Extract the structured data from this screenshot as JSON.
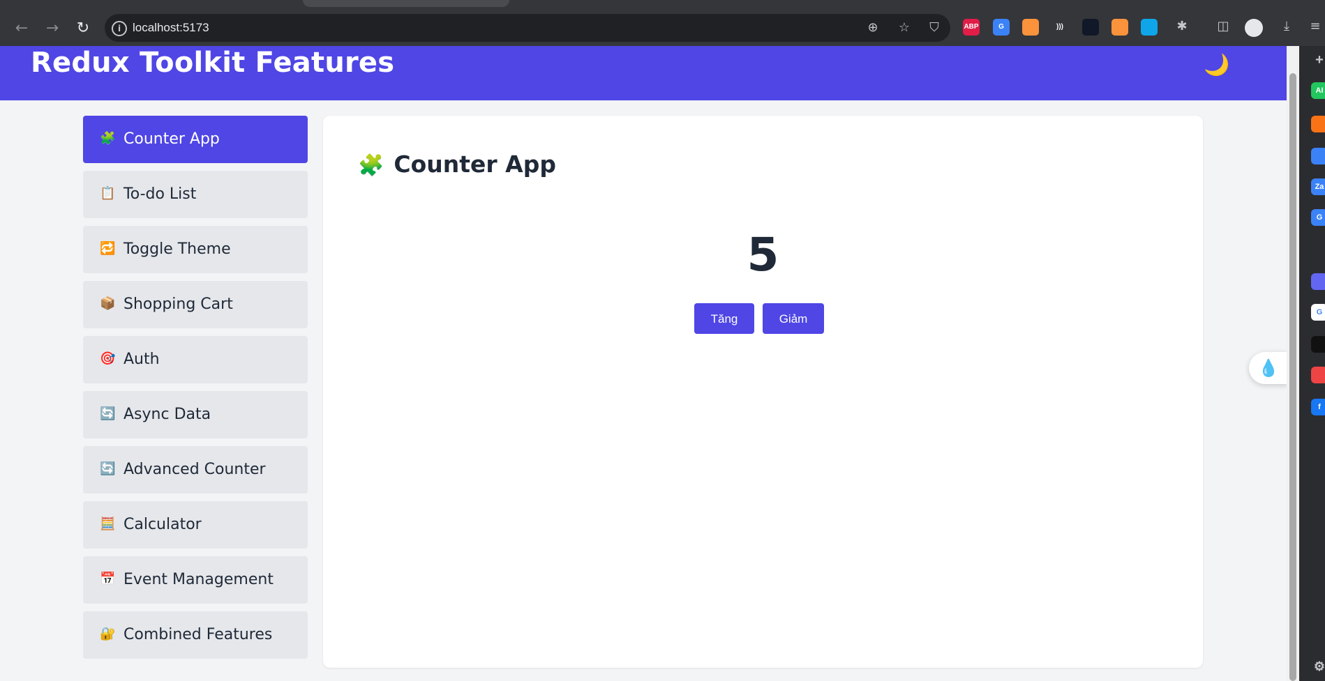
{
  "browser": {
    "url": "localhost:5173",
    "extensions": [
      {
        "name": "adblock-plus",
        "label": "ABP",
        "color": "#e11d48"
      },
      {
        "name": "google-translate",
        "label": "G",
        "color": "#3b82f6"
      },
      {
        "name": "ext-orange",
        "label": "",
        "color": "#fb923c"
      },
      {
        "name": "ext-waves",
        "label": ")))",
        "color": "#35363a"
      },
      {
        "name": "ext-pen",
        "label": "",
        "color": "#111827"
      },
      {
        "name": "ext-doc",
        "label": "",
        "color": "#fb923c"
      },
      {
        "name": "ext-drop",
        "label": "",
        "color": "#0ea5e9"
      }
    ],
    "side_strip": [
      {
        "name": "ai-chat-icon",
        "label": "AI",
        "color": "#22c55e"
      },
      {
        "name": "crown-icon",
        "label": "",
        "color": "#f97316"
      },
      {
        "name": "messenger-icon",
        "label": "",
        "color": "#3b82f6"
      },
      {
        "name": "zalo-icon",
        "label": "Za",
        "color": "#3b82f6"
      },
      {
        "name": "translate-icon",
        "label": "G",
        "color": "#3b82f6"
      },
      {
        "name": "link-icon",
        "label": "",
        "color": "#6366f1"
      },
      {
        "name": "google-icon",
        "label": "G",
        "color": "#ffffff"
      },
      {
        "name": "openai-icon",
        "label": "",
        "color": "#111111"
      },
      {
        "name": "youtube-icon",
        "label": "",
        "color": "#ef4444"
      },
      {
        "name": "facebook-icon",
        "label": "f",
        "color": "#1877f2"
      }
    ]
  },
  "app": {
    "title": "Redux Toolkit Features",
    "theme_icon": "🌙"
  },
  "sidebar": {
    "items": [
      {
        "emoji": "🧩",
        "label": "Counter App",
        "active": true
      },
      {
        "emoji": "📋",
        "label": "To-do List",
        "active": false
      },
      {
        "emoji": "🔁",
        "label": "Toggle Theme",
        "active": false
      },
      {
        "emoji": "📦",
        "label": "Shopping Cart",
        "active": false
      },
      {
        "emoji": "🎯",
        "label": "Auth",
        "active": false
      },
      {
        "emoji": "🔄",
        "label": "Async Data",
        "active": false
      },
      {
        "emoji": "🔄",
        "label": "Advanced Counter",
        "active": false
      },
      {
        "emoji": "🧮",
        "label": "Calculator",
        "active": false
      },
      {
        "emoji": "📅",
        "label": "Event Management",
        "active": false
      },
      {
        "emoji": "🔐",
        "label": "Combined Features",
        "active": false
      }
    ]
  },
  "main": {
    "title_emoji": "🧩",
    "title": "Counter App",
    "count": "5",
    "increase_label": "Tăng",
    "decrease_label": "Giảm"
  },
  "colors": {
    "accent": "#4f46e5",
    "sidebar_item_bg": "#e5e7eb",
    "page_bg": "#f3f4f6"
  }
}
